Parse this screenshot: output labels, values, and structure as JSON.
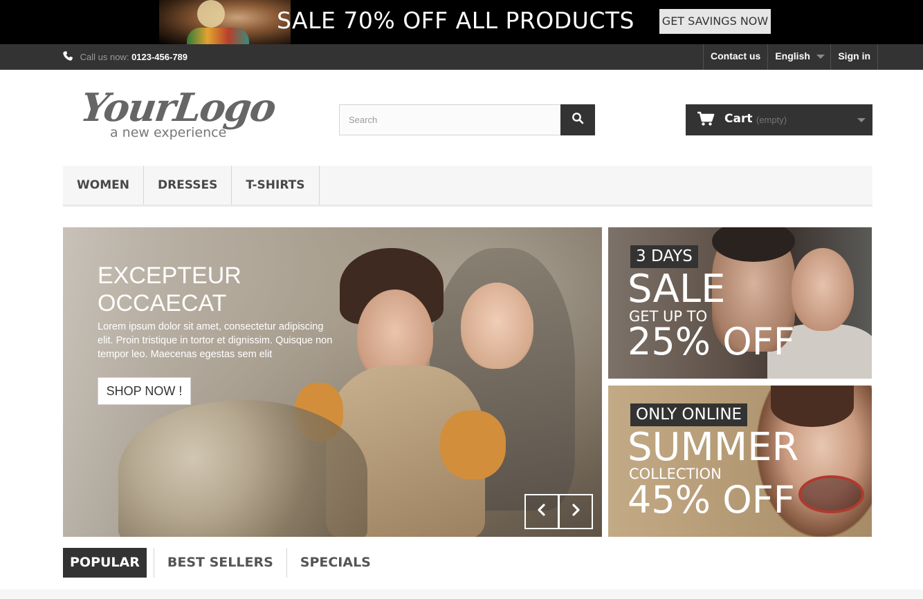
{
  "promo": {
    "text": "SALE 70% OFF ALL PRODUCTS",
    "button": "GET SAVINGS NOW"
  },
  "topnav": {
    "call_label": "Call us now:",
    "phone": "0123-456-789",
    "contact": "Contact us",
    "language": "English",
    "signin": "Sign in"
  },
  "header": {
    "logo_main": "YourLogo",
    "logo_tagline": "a new experience",
    "search_placeholder": "Search",
    "cart_label": "Cart",
    "cart_status": "(empty)"
  },
  "menu": {
    "items": [
      "WOMEN",
      "DRESSES",
      "T-SHIRTS"
    ]
  },
  "slider": {
    "title_line1": "EXCEPTEUR",
    "title_line2": "OCCAECAT",
    "text": "Lorem ipsum dolor sit amet, consectetur adipiscing elit. Proin tristique in tortor et dignissim. Quisque non tempor leo. Maecenas egestas sem elit",
    "button": "SHOP NOW !"
  },
  "banners": [
    {
      "tag": "3 DAYS",
      "big": "SALE",
      "mid": "GET UP TO",
      "pct": "25% OFF"
    },
    {
      "tag": "ONLY ONLINE",
      "big": "SUMMER",
      "mid": "COLLECTION",
      "pct": "45% OFF"
    }
  ],
  "tabs": [
    "POPULAR",
    "BEST SELLERS",
    "SPECIALS"
  ],
  "colors": {
    "dark": "#333333",
    "menu_bg": "#f6f6f6",
    "border": "#d6d4d4"
  },
  "icons": [
    "phone-icon",
    "search-icon",
    "cart-icon",
    "chevron-down-icon",
    "chevron-left-icon",
    "chevron-right-icon"
  ]
}
